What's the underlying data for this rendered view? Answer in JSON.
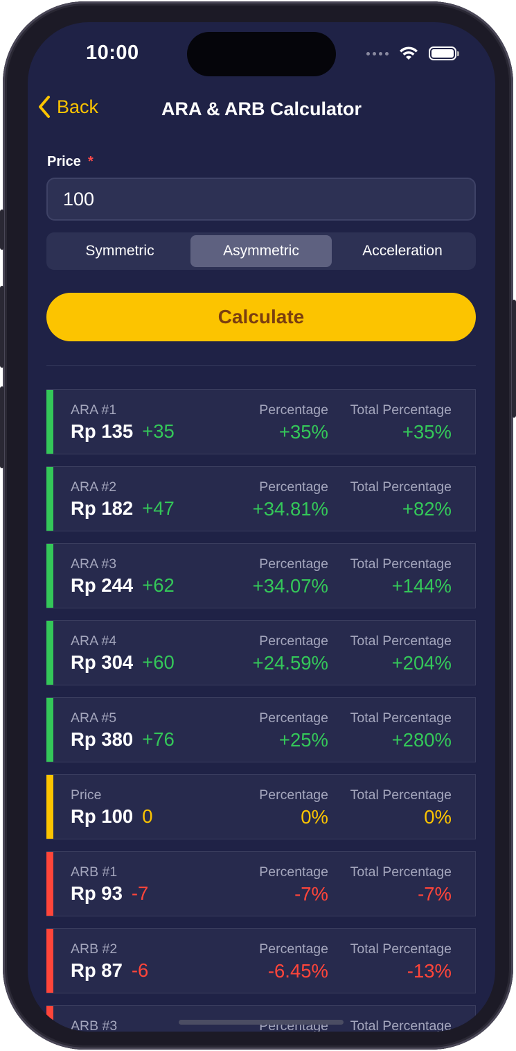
{
  "status": {
    "time": "10:00"
  },
  "nav": {
    "back_label": "Back",
    "title": "ARA & ARB Calculator"
  },
  "form": {
    "price_label": "Price",
    "required_marker": "*",
    "price_value": "100",
    "segments": [
      "Symmetric",
      "Asymmetric",
      "Acceleration"
    ],
    "selected_segment": "Asymmetric",
    "calculate_label": "Calculate"
  },
  "colors": {
    "up": "#34c759",
    "neutral": "#fcc400",
    "down": "#ff453a",
    "accent": "#fcc400"
  },
  "results": {
    "percentage_header": "Percentage",
    "total_header": "Total Percentage",
    "rows": [
      {
        "kind": "up",
        "label": "ARA #1",
        "price": "Rp 135",
        "delta": "+35",
        "pct": "+35%",
        "total": "+35%"
      },
      {
        "kind": "up",
        "label": "ARA #2",
        "price": "Rp 182",
        "delta": "+47",
        "pct": "+34.81%",
        "total": "+82%"
      },
      {
        "kind": "up",
        "label": "ARA #3",
        "price": "Rp 244",
        "delta": "+62",
        "pct": "+34.07%",
        "total": "+144%"
      },
      {
        "kind": "up",
        "label": "ARA #4",
        "price": "Rp 304",
        "delta": "+60",
        "pct": "+24.59%",
        "total": "+204%"
      },
      {
        "kind": "up",
        "label": "ARA #5",
        "price": "Rp 380",
        "delta": "+76",
        "pct": "+25%",
        "total": "+280%"
      },
      {
        "kind": "neutral",
        "label": "Price",
        "price": "Rp 100",
        "delta": "0",
        "pct": "0%",
        "total": "0%"
      },
      {
        "kind": "down",
        "label": "ARB #1",
        "price": "Rp 93",
        "delta": "-7",
        "pct": "-7%",
        "total": "-7%"
      },
      {
        "kind": "down",
        "label": "ARB #2",
        "price": "Rp 87",
        "delta": "-6",
        "pct": "-6.45%",
        "total": "-13%"
      },
      {
        "kind": "down",
        "label": "ARB #3",
        "price": "",
        "delta": "",
        "pct": "",
        "total": ""
      }
    ]
  }
}
